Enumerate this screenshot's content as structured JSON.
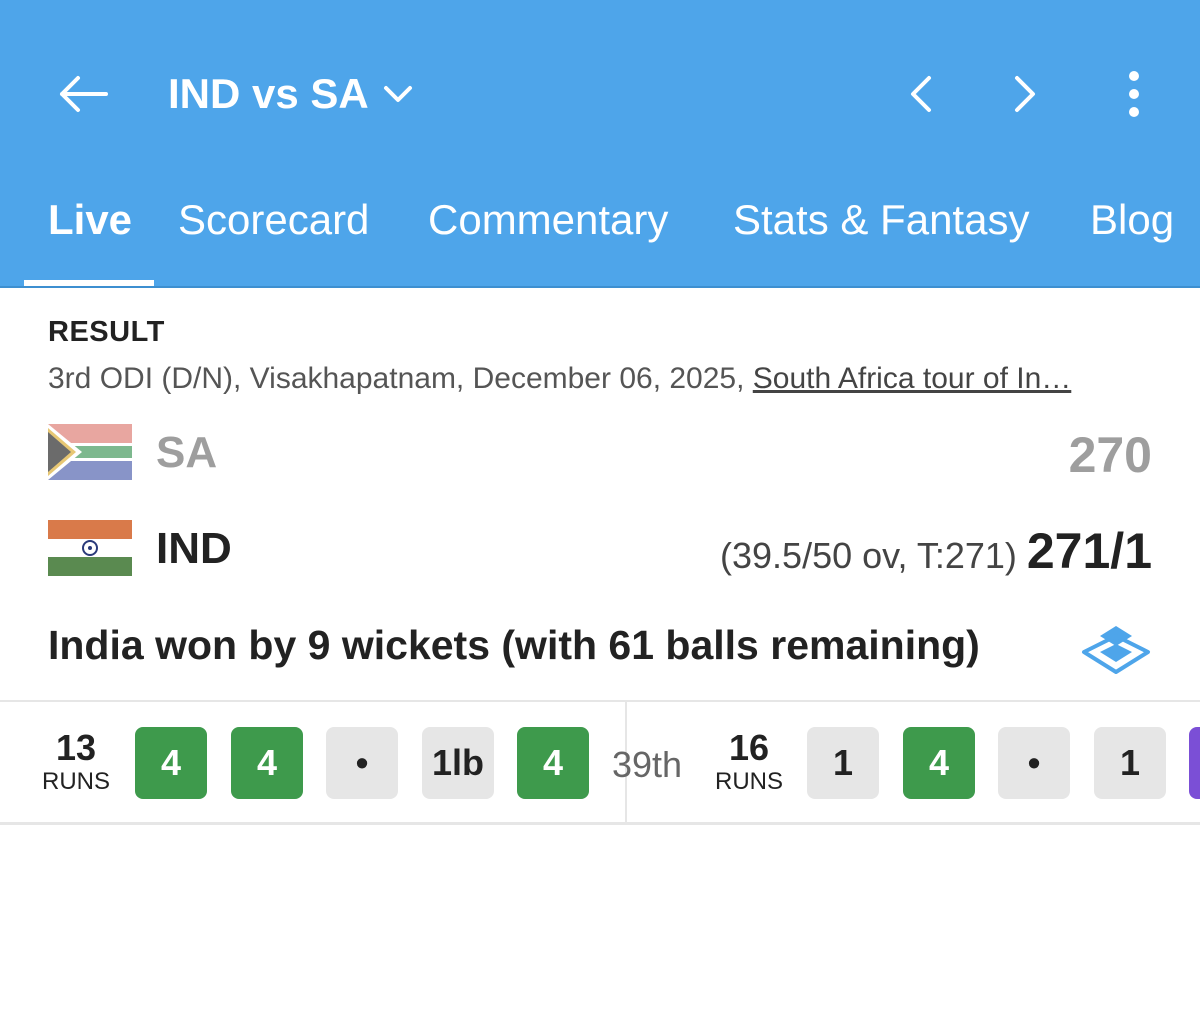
{
  "header": {
    "title": "IND vs SA",
    "colors": {
      "background": "#4ea5ea"
    },
    "icons": [
      "back-arrow-icon",
      "chevron-down-icon",
      "chevron-left-icon",
      "chevron-right-icon",
      "more-vert-icon"
    ]
  },
  "tabs": [
    {
      "label": "Live",
      "active": true
    },
    {
      "label": "Scorecard",
      "active": false
    },
    {
      "label": "Commentary",
      "active": false
    },
    {
      "label": "Stats & Fantasy",
      "active": false
    },
    {
      "label": "Blog",
      "active": false
    }
  ],
  "result": {
    "status": "RESULT",
    "match_info": "3rd ODI (D/N), Visakhapatnam, December 06, 2025, ",
    "series": "South Africa tour of In…",
    "teams": [
      {
        "name": "SA",
        "score": "270",
        "meta": "",
        "color": "#9e9e9e"
      },
      {
        "name": "IND",
        "score": "271/1",
        "meta": "(39.5/50 ov, T:271)",
        "color": "#222222"
      }
    ],
    "summary": "India won by 9 wickets (with 61 balls remaining)"
  },
  "overs": {
    "previous": {
      "runs": "13",
      "runs_label": "RUNS",
      "balls": [
        "4",
        "4",
        "•",
        "1lb",
        "4"
      ]
    },
    "over_label": "39th",
    "current": {
      "runs": "16",
      "runs_label": "RUNS",
      "balls": [
        "1",
        "4",
        "•",
        "1"
      ]
    }
  }
}
